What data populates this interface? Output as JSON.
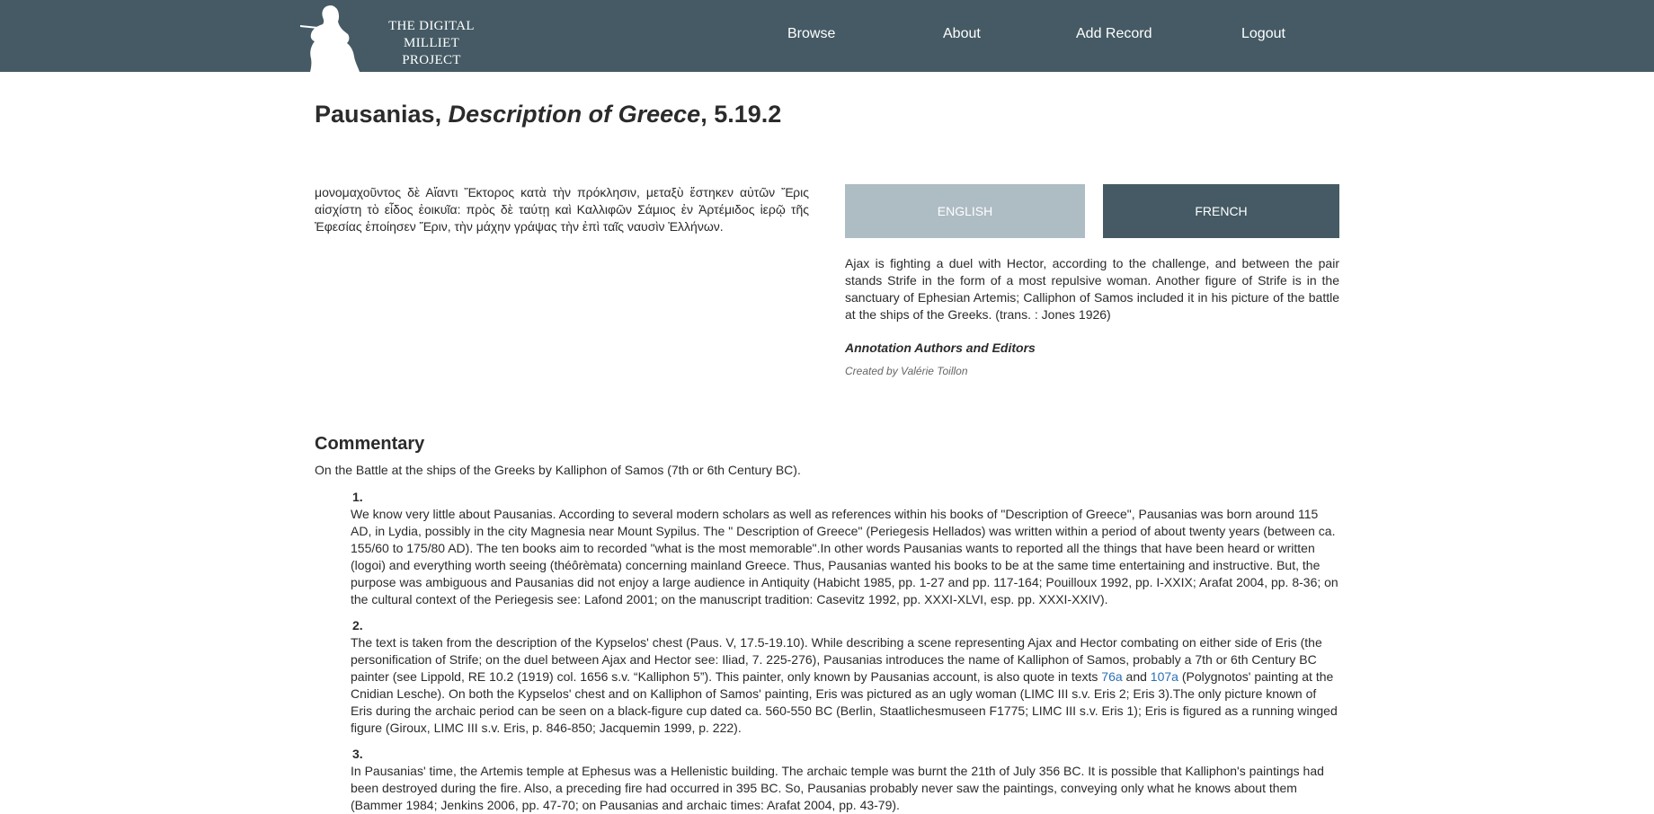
{
  "header": {
    "logo_line1": "THE DIGITAL MILLIET",
    "logo_line2": "PROJECT",
    "nav": {
      "browse": "Browse",
      "about": "About",
      "add_record": "Add Record",
      "logout": "Logout"
    },
    "bg_color": "#455a64"
  },
  "record": {
    "title_prefix": "Pausanias, ",
    "title_work": "Description of Greece",
    "title_suffix": ", 5.19.2",
    "greek_text": "μονομαχοῦντος δὲ Αἴαντι Ἕκτορος κατὰ τὴν πρόκλησιν, μεταξὺ ἕστηκεν αὐτῶν Ἔρις αἰσχίστη τὸ εἶδος ἐοικυῖα: πρὸς δὲ ταύτῃ καὶ Καλλιφῶν Σάμιος ἐν Ἀρτέμιδος ἱερῷ τῆς Ἐφεσίας ἐποίησεν Ἔριν, τὴν μάχην γράψας τὴν ἐπὶ ταῖς ναυσὶν Ἑλλήνων.",
    "tabs": {
      "english": "ENGLISH",
      "french": "FRENCH"
    },
    "translation": "Ajax is fighting a duel with Hector, according to the challenge, and between the pair stands Strife in the form of a most repulsive woman. Another figure of Strife is in the sanctuary of Ephesian Artemis; Calliphon of Samos included it in his picture of the battle at the ships of the Greeks. (trans. : Jones 1926)",
    "annotation_heading": "Annotation Authors and Editors",
    "created_by": "Created by Valérie Toillon"
  },
  "commentary": {
    "heading": "Commentary",
    "subtitle": "On the Battle at the ships of the Greeks by Kalliphon of Samos (7th or 6th Century BC).",
    "notes": [
      {
        "num": "1.",
        "text": "We know very little about Pausanias. According to several modern scholars as well as references within his books of \"Description of Greece\", Pausanias was born around 115 AD, in Lydia, possibly in the city Magnesia near Mount Sypilus. The \" Description of Greece\" (Periegesis Hellados) was written within a period of about twenty years (between ca. 155/60 to 175/80 AD). The ten books aim to recorded \"what is the most memorable\".In other words Pausanias wants to reported all the things that have been heard or written (logoi) and everything worth seeing (théôrèmata) concerning mainland Greece. Thus, Pausanias wanted his books to be at the same time entertaining and instructive. But, the purpose was ambiguous and Pausanias did not enjoy a large audience in Antiquity (Habicht 1985, pp. 1-27 and pp. 117-164; Pouilloux 1992, pp. I-XXIX; Arafat 2004, pp. 8-36; on the cultural context of the Periegesis see: Lafond 2001; on the manuscript tradition: Casevitz 1992, pp. XXXI-XLVI, esp. pp. XXXI-XXIV)."
      },
      {
        "num": "2.",
        "text_before": "The text is taken from the description of the Kypselos' chest (Paus. V, 17.5-19.10). While describing a scene representing Ajax and Hector combating on either side of Eris (the personification of Strife; on the duel between Ajax and Hector see: Iliad, 7. 225-276), Pausanias introduces the name of Kalliphon of Samos, probably a 7th or 6th Century BC painter (see Lippold, RE 10.2 (1919) col. 1656 s.v. “Kalliphon 5”). This painter, only known by Pausanias account, is also quote in texts ",
        "link1": "76a",
        "text_mid": " and ",
        "link2": "107a",
        "text_after": " (Polygnotos' painting at the Cnidian Lesche). On both the Kypselos' chest and on Kalliphon of Samos' painting, Eris was pictured as an ugly woman (LIMC III s.v. Eris 2; Eris 3).The only picture known of Eris during the archaic period can be seen on a black-figure cup dated ca. 560-550 BC (Berlin, Staatlichesmuseen F1775; LIMC III s.v. Eris 1); Eris is figured as a running winged figure (Giroux, LIMC III s.v. Eris, p. 846-850; Jacquemin 1999, p. 222)."
      },
      {
        "num": "3.",
        "text": "In Pausanias' time, the Artemis temple at Ephesus was a Hellenistic building. The archaic temple was burnt the 21th of July 356 BC. It is possible that Kalliphon's paintings had been destroyed during the fire. Also, a preceding fire had occurred in 395 BC. So, Pausanias probably never saw the paintings, conveying only what he knows about them (Bammer 1984; Jenkins 2006, pp. 47-70; on Pausanias and archaic times: Arafat 2004, pp. 43-79)."
      }
    ]
  }
}
